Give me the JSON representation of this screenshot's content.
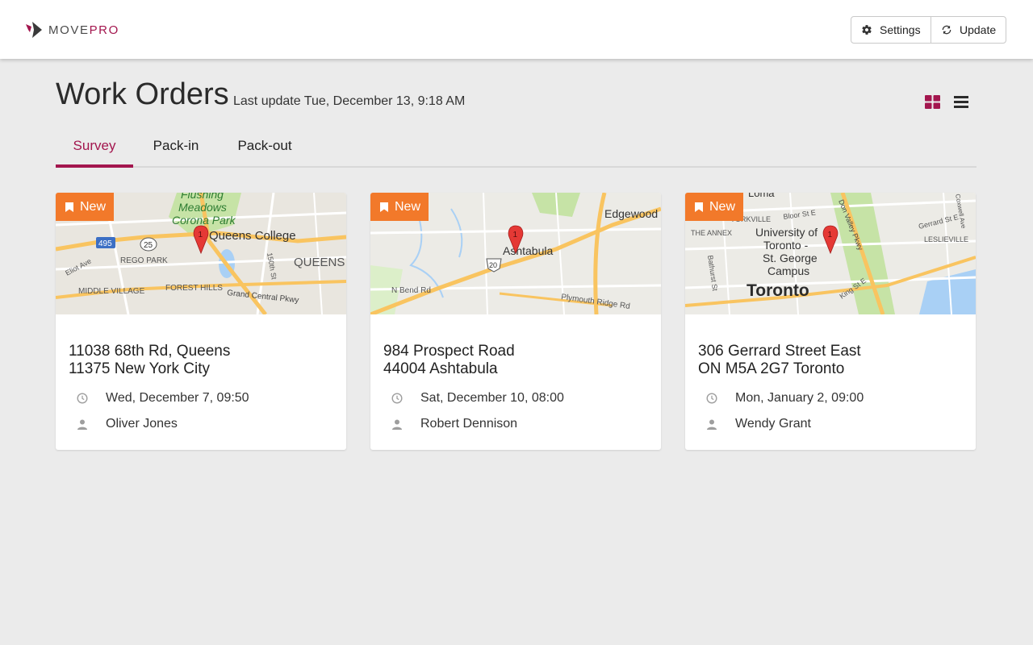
{
  "brand": {
    "move": "MOVE",
    "pro": "PRO"
  },
  "header": {
    "settings_label": "Settings",
    "update_label": "Update"
  },
  "page": {
    "title": "Work Orders",
    "last_update": "Last update Tue, December 13, 9:18 AM"
  },
  "view_toggle": {
    "active": "grid",
    "options": [
      "grid-view-icon",
      "list-view-icon"
    ]
  },
  "tabs": [
    {
      "label": "Survey",
      "active": true
    },
    {
      "label": "Pack-in",
      "active": false
    },
    {
      "label": "Pack-out",
      "active": false
    }
  ],
  "orders": [
    {
      "badge": "New",
      "address_line1": "11038 68th Rd, Queens",
      "address_line2": "11375 New York City",
      "date": "Wed, December 7, 09:50",
      "person": "Oliver Jones",
      "map_labels": {
        "a": "Flushing",
        "b": "Meadows",
        "c": "Corona Park",
        "d": "Queens College",
        "e": "REGO PARK",
        "f": "QUEENS",
        "g": "MIDDLE VILLAGE",
        "h": "FOREST HILLS",
        "i": "Grand Central Pkwy",
        "j": "Eliot Ave",
        "k": "150th St",
        "shield1": "495",
        "shield2": "25"
      }
    },
    {
      "badge": "New",
      "address_line1": "984 Prospect Road",
      "address_line2": "44004 Ashtabula",
      "date": "Sat, December 10, 08:00",
      "person": "Robert Dennison",
      "map_labels": {
        "a": "Edgewood",
        "b": "Ashtabula",
        "c": "N Bend Rd",
        "d": "Plymouth Ridge Rd",
        "shield1": "20"
      }
    },
    {
      "badge": "New",
      "address_line1": "306 Gerrard Street East",
      "address_line2": "ON M5A 2G7 Toronto",
      "date": "Mon, January 2, 09:00",
      "person": "Wendy Grant",
      "map_labels": {
        "a": "Loma",
        "b": "YORKVILLE",
        "c": "Bloor St E",
        "d": "Don Valley Pkwy",
        "e": "Gerrard St E",
        "f": "THE ANNEX",
        "g": "University of",
        "h": "Toronto -",
        "i": "St. George",
        "j": "Campus",
        "k": "LESLIEVILLE",
        "l": "Toronto",
        "m": "Bathurst St",
        "n": "King St E",
        "o": "Coxwell Ave"
      }
    }
  ],
  "colors": {
    "accent": "#a3164e",
    "badge": "#f2792a",
    "background": "#ebebeb",
    "map_land": "#e9e6df",
    "map_road_major": "#f9c460",
    "map_park": "#c6e3a6",
    "map_water": "#a9d0f5",
    "pin": "#e53935"
  }
}
